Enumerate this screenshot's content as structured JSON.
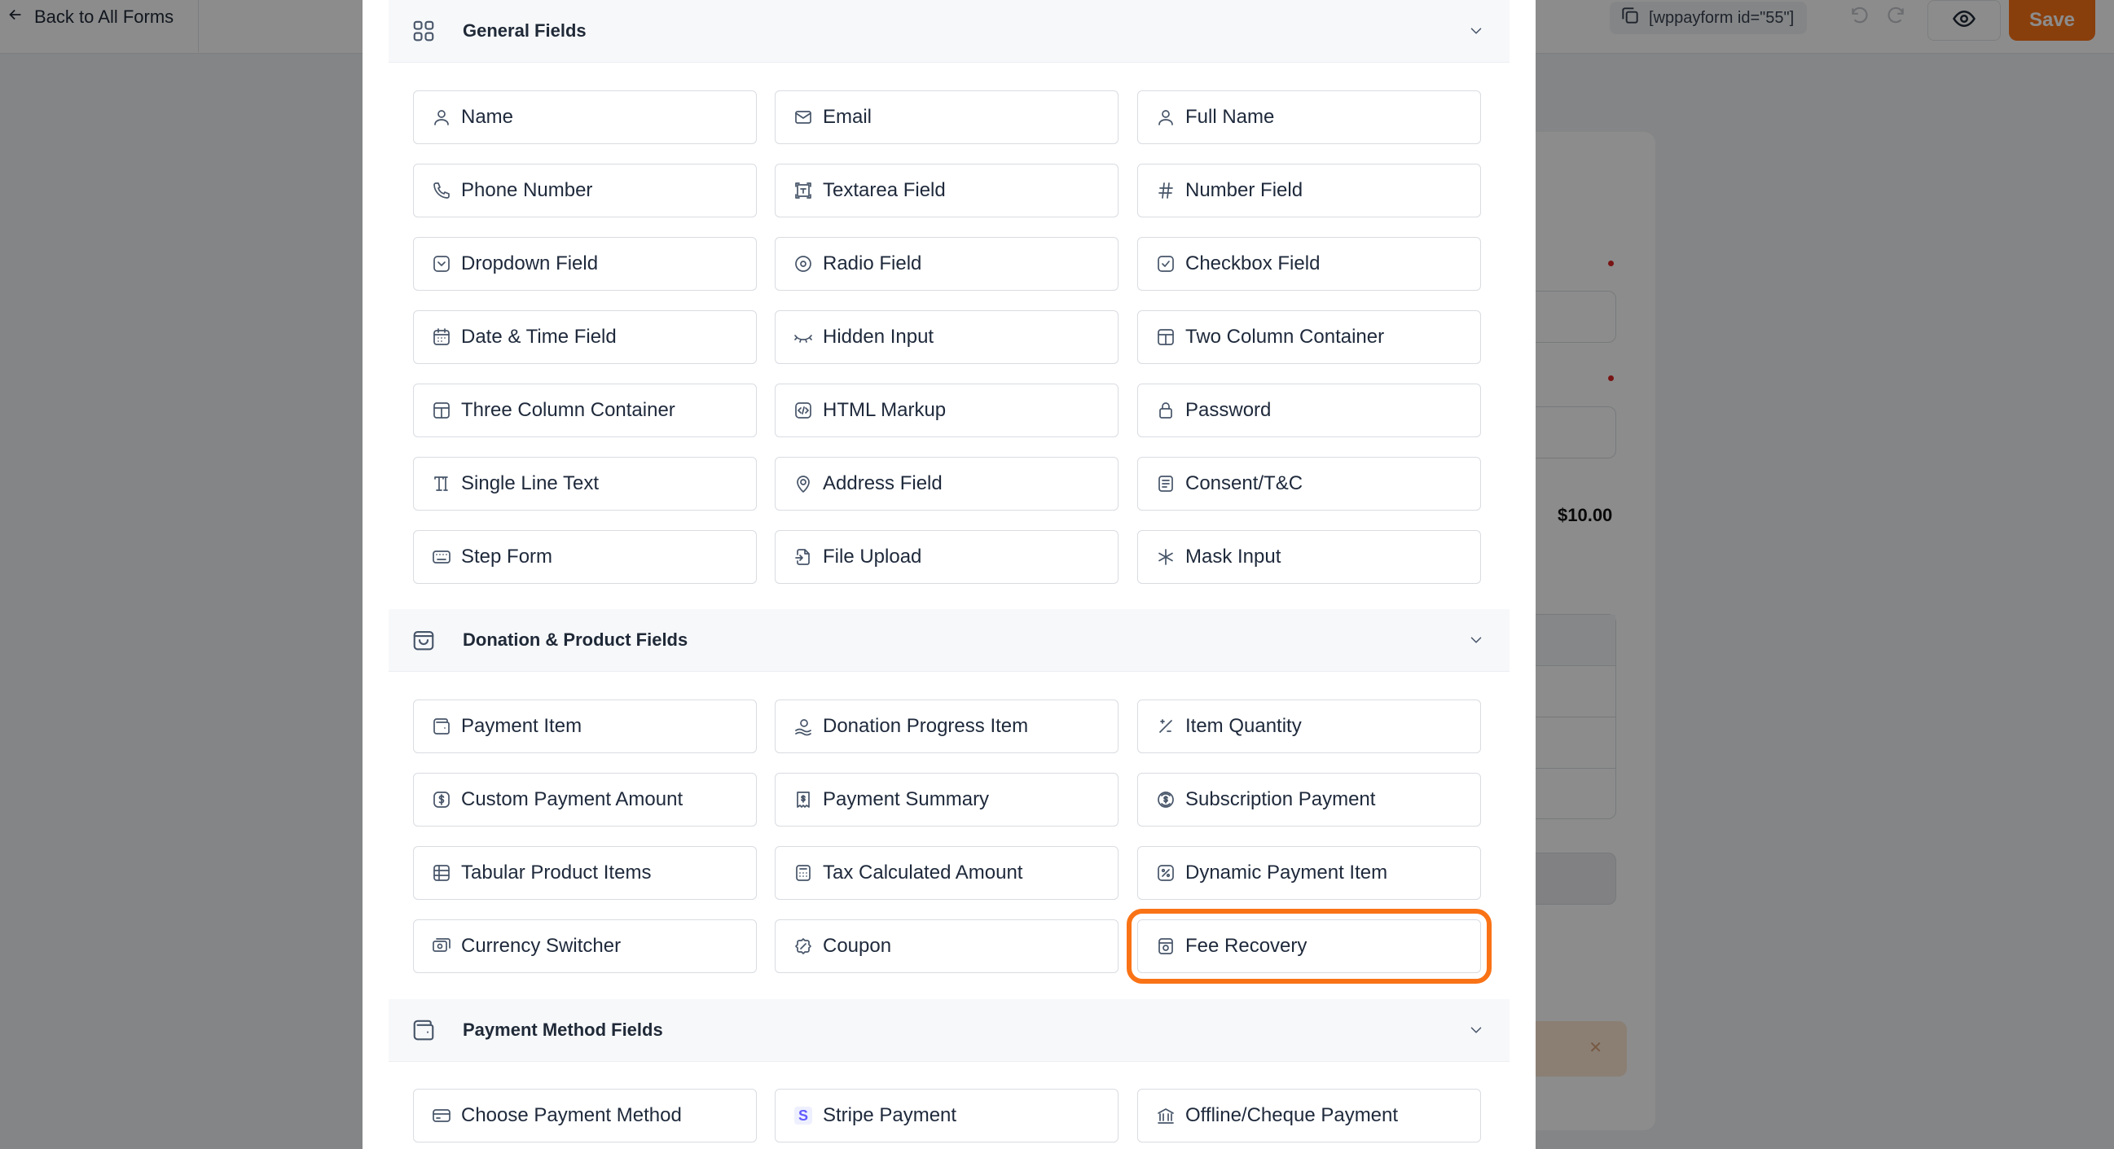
{
  "topbar": {
    "back_label": "Back to All Forms",
    "shortcode": "[wppayform id=\"55\"]",
    "save_label": "Save"
  },
  "background": {
    "price": "$10.00"
  },
  "sections": [
    {
      "title": "General Fields",
      "icon": "grid-icon",
      "fields": [
        {
          "label": "Name",
          "icon": "user-icon"
        },
        {
          "label": "Email",
          "icon": "mail-icon"
        },
        {
          "label": "Full Name",
          "icon": "user-icon"
        },
        {
          "label": "Phone Number",
          "icon": "phone-icon"
        },
        {
          "label": "Textarea Field",
          "icon": "textarea-icon"
        },
        {
          "label": "Number Field",
          "icon": "hash-icon"
        },
        {
          "label": "Dropdown Field",
          "icon": "dropdown-icon"
        },
        {
          "label": "Radio Field",
          "icon": "radio-icon"
        },
        {
          "label": "Checkbox Field",
          "icon": "checkbox-icon"
        },
        {
          "label": "Date & Time Field",
          "icon": "calendar-icon"
        },
        {
          "label": "Hidden Input",
          "icon": "eye-closed-icon"
        },
        {
          "label": "Two Column Container",
          "icon": "columns-icon"
        },
        {
          "label": "Three Column Container",
          "icon": "columns-icon"
        },
        {
          "label": "HTML Markup",
          "icon": "code-icon"
        },
        {
          "label": "Password",
          "icon": "lock-icon"
        },
        {
          "label": "Single Line Text",
          "icon": "text-icon"
        },
        {
          "label": "Address Field",
          "icon": "location-icon"
        },
        {
          "label": "Consent/T&C",
          "icon": "document-icon"
        },
        {
          "label": "Step Form",
          "icon": "keyboard-icon"
        },
        {
          "label": "File Upload",
          "icon": "file-upload-icon"
        },
        {
          "label": "Mask Input",
          "icon": "asterisk-icon"
        }
      ]
    },
    {
      "title": "Donation & Product Fields",
      "icon": "shopping-bag-icon",
      "fields": [
        {
          "label": "Payment Item",
          "icon": "wallet-icon"
        },
        {
          "label": "Donation Progress Item",
          "icon": "donation-icon"
        },
        {
          "label": "Item Quantity",
          "icon": "quantity-icon"
        },
        {
          "label": "Custom Payment Amount",
          "icon": "dollar-icon"
        },
        {
          "label": "Payment Summary",
          "icon": "receipt-icon"
        },
        {
          "label": "Subscription Payment",
          "icon": "subscription-icon"
        },
        {
          "label": "Tabular Product Items",
          "icon": "table-icon"
        },
        {
          "label": "Tax Calculated Amount",
          "icon": "calculator-icon"
        },
        {
          "label": "Dynamic Payment Item",
          "icon": "percent-icon"
        },
        {
          "label": "Currency Switcher",
          "icon": "currency-icon"
        },
        {
          "label": "Coupon",
          "icon": "coupon-icon"
        },
        {
          "label": "Fee Recovery",
          "icon": "fee-icon"
        }
      ]
    },
    {
      "title": "Payment Method Fields",
      "icon": "wallet-icon",
      "fields": [
        {
          "label": "Choose Payment Method",
          "icon": "card-icon"
        },
        {
          "label": "Stripe Payment",
          "icon": "stripe-icon"
        },
        {
          "label": "Offline/Cheque Payment",
          "icon": "bank-icon"
        }
      ]
    }
  ],
  "highlighted_field": "Fee Recovery",
  "colors": {
    "accent": "#f97316",
    "border": "#d9dce1",
    "header_bg": "#f7f8fa"
  }
}
